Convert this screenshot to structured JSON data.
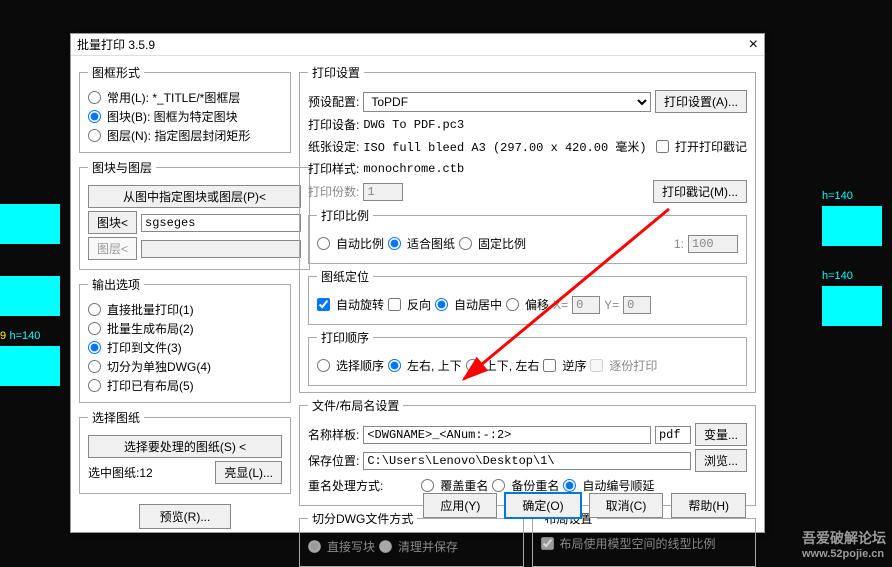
{
  "window": {
    "title": "批量打印 3.5.9"
  },
  "frame_style": {
    "legend": "图框形式",
    "opt_common": "常用(L): *_TITLE/*图框层",
    "opt_block": "图块(B): 图框为特定图块",
    "opt_layer": "图层(N): 指定图层封闭矩形"
  },
  "block_layer": {
    "legend": "图块与图层",
    "btn_specify": "从图中指定图块或图层(P)<",
    "block_btn": "图块<",
    "block_val": "sgseges",
    "layer_btn": "图层<",
    "layer_val": ""
  },
  "output": {
    "legend": "输出选项",
    "o1": "直接批量打印(1)",
    "o2": "批量生成布局(2)",
    "o3": "打印到文件(3)",
    "o4": "切分为单独DWG(4)",
    "o5": "打印已有布局(5)"
  },
  "select_paper": {
    "legend": "选择图纸",
    "btn": "选择要处理的图纸(S) <",
    "count_label": "选中图纸:12",
    "highlight_btn": "亮显(L)..."
  },
  "preview_btn": "预览(R)...",
  "print_cfg": {
    "legend": "打印设置",
    "preset_label": "预设配置:",
    "preset_val": "ToPDF",
    "cfg_btn": "打印设置(A)...",
    "device_label": "打印设备:",
    "device_val": "DWG To PDF.pc3",
    "paper_label": "纸张设定:",
    "paper_val": "ISO full bleed A3 (297.00 x 420.00 毫米)",
    "style_label": "打印样式:",
    "style_val": "monochrome.ctb",
    "open_stamp": "打开打印戳记",
    "copies_label": "打印份数:",
    "copies_val": "1",
    "stamp_btn": "打印戳记(M)..."
  },
  "scale": {
    "legend": "打印比例",
    "auto": "自动比例",
    "fit": "适合图纸",
    "fixed": "固定比例",
    "ratio_sep": "1:",
    "ratio_val": "100"
  },
  "orient": {
    "legend": "图纸定位",
    "autorotate": "自动旋转",
    "reverse": "反向",
    "center": "自动居中",
    "offset": "偏移",
    "x_label": "X=",
    "x_val": "0",
    "y_label": "Y=",
    "y_val": "0"
  },
  "order": {
    "legend": "打印顺序",
    "o_pick": "选择顺序",
    "o_lr_tb": "左右, 上下",
    "o_tb_lr": "上下, 左右",
    "rev": "逆序",
    "dup": "逐份打印"
  },
  "file_layout": {
    "legend": "文件/布局名设置",
    "tmpl_label": "名称样板:",
    "tmpl_val": "<DWGNAME>_<ANum:-:2>",
    "ext_val": "pdf",
    "var_btn": "变量...",
    "save_label": "保存位置:",
    "save_val": "C:\\Users\\Lenovo\\Desktop\\1\\",
    "browse_btn": "浏览...",
    "dup_label": "重名处理方式:",
    "dup_overwrite": "覆盖重名",
    "dup_backup": "备份重名",
    "dup_autoinc": "自动编号顺延"
  },
  "split_dwg": {
    "legend": "切分DWG文件方式",
    "direct": "直接写块",
    "clean": "清理并保存"
  },
  "layout_cfg": {
    "legend": "布局设置",
    "use_model_ltype": "布局使用模型空间的线型比例"
  },
  "buttons": {
    "apply": "应用(Y)",
    "ok": "确定(O)",
    "cancel": "取消(C)",
    "help": "帮助(H)"
  },
  "thumbs": {
    "h_label": "h=140",
    "sel_label": "9"
  },
  "watermark": {
    "site": "吾爱破解论坛",
    "url": "www.52pojie.cn"
  }
}
